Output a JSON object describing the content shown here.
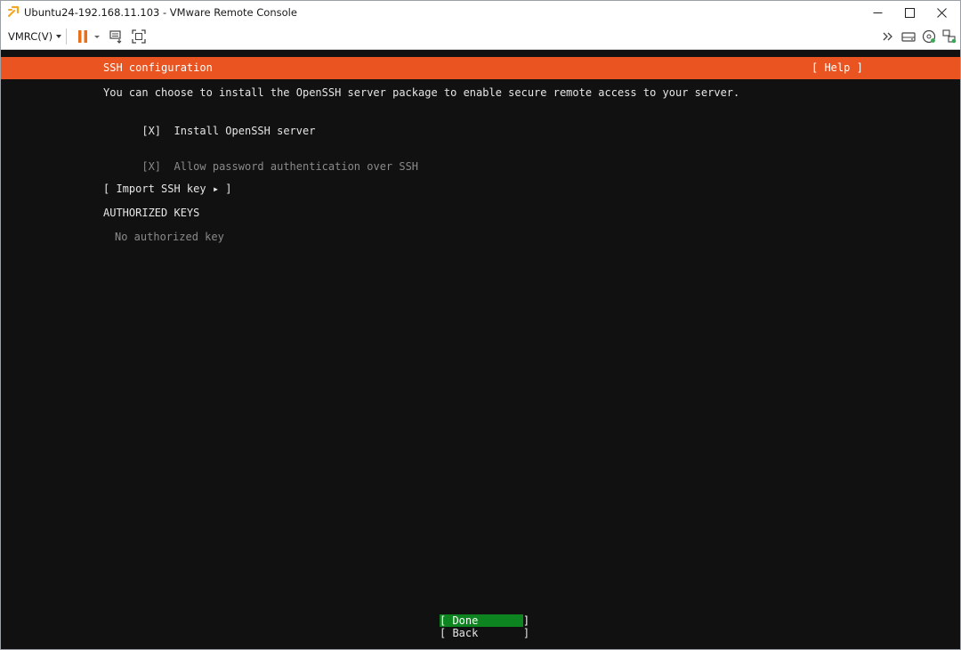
{
  "window": {
    "title": "Ubuntu24-192.168.11.103 - VMware Remote Console"
  },
  "toolbar": {
    "vmrc_menu_label": "VMRC(V)",
    "icons": [
      "pause-icon",
      "send-keys-icon",
      "fullscreen-icon",
      "more-icon",
      "drive-icon",
      "cd-icon",
      "network-icon"
    ]
  },
  "colors": {
    "header_accent": "#e95420",
    "done_button": "#0e8420",
    "console_bg": "#111111"
  },
  "installer": {
    "header_title": "SSH configuration",
    "help_label": "[ Help ]",
    "description": "You can choose to install the OpenSSH server package to enable secure remote access to your server.",
    "install_openssh": {
      "mark": "[X]",
      "label": "Install OpenSSH server"
    },
    "allow_password": {
      "mark": "[X]",
      "label": "Allow password authentication over SSH"
    },
    "import_key_label": "[ Import SSH key ▸ ]",
    "authorized_keys_heading": "AUTHORIZED KEYS",
    "no_keys_text": "No authorized key",
    "done_label": "[ Done       ]",
    "back_label": "[ Back       ]"
  }
}
